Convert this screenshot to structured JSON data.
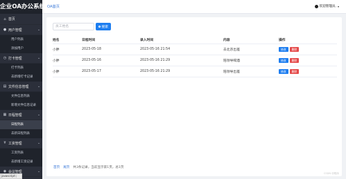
{
  "app": {
    "title": "企业OA办公系统"
  },
  "header": {
    "breadcrumb": "OA首页",
    "user_label": "欢迎管理员,"
  },
  "sidebar": {
    "home": "首页",
    "groups": [
      {
        "label": "用户管理",
        "items": [
          "用户列表",
          "添加用户"
        ]
      },
      {
        "label": "打卡管理",
        "items": [
          "打卡列表",
          "去新增打卡记录"
        ]
      },
      {
        "label": "文件信息管理",
        "items": [
          "文件信息列表",
          "新增文件信息记录"
        ]
      },
      {
        "label": "日程管理",
        "items": [
          "日程列表",
          "去新日程列表"
        ]
      },
      {
        "label": "工资管理",
        "items": [
          "工资列表",
          "去新增工资记录"
        ]
      },
      {
        "label": "会议管理",
        "items": []
      }
    ],
    "active_item": "日程列表"
  },
  "status_tip": "javascript:;",
  "search": {
    "placeholder": "员工姓名",
    "button_label": "搜索"
  },
  "table": {
    "headers": [
      "姓名",
      "日程时间",
      "录入时间",
      "内容",
      "操作"
    ],
    "rows": [
      {
        "name": "小胖",
        "date": "2023-05-18",
        "created": "2023-05-16 21:54",
        "content": "去北京出差"
      },
      {
        "name": "小胖",
        "date": "2023-05-16",
        "created": "2023-05-16 21:29",
        "content": "陪领导喝酒"
      },
      {
        "name": "小胖",
        "date": "2023-05-17",
        "created": "2023-05-16 21:29",
        "content": "陪领导出差"
      }
    ],
    "edit_label": "修改",
    "delete_label": "删除"
  },
  "pager": {
    "first": "首页",
    "last": "尾页",
    "info": "共3条记录，当前显示第1页，总1页"
  },
  "watermark": "CSDN @程序",
  "colors": {
    "primary": "#1e7ef0",
    "danger": "#e54b4b",
    "sidebar_bg": "#2b2f3a"
  }
}
